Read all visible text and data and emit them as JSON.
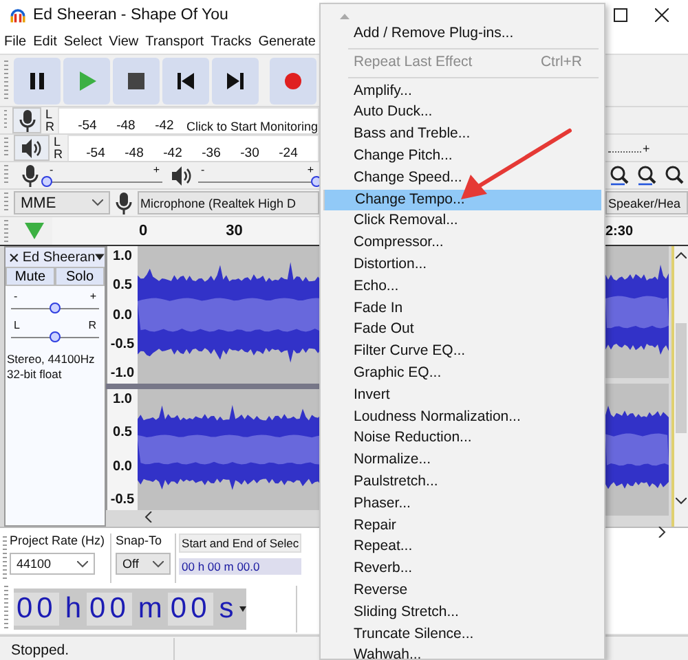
{
  "window": {
    "title": "Ed Sheeran - Shape Of You"
  },
  "menu_bar": [
    "File",
    "Edit",
    "Select",
    "View",
    "Transport",
    "Tracks",
    "Generate"
  ],
  "transport_buttons": [
    {
      "kind": "pause"
    },
    {
      "kind": "play"
    },
    {
      "kind": "stop"
    },
    {
      "kind": "skip_start"
    },
    {
      "kind": "skip_end"
    },
    {
      "kind": "record"
    }
  ],
  "record_meter": {
    "channels": [
      "L",
      "R"
    ],
    "ticks": [
      "-54",
      "-48",
      "-42"
    ],
    "prompt": "Click to Start Monitoring"
  },
  "playback_meter": {
    "channels": [
      "L",
      "R"
    ],
    "ticks": [
      "-54",
      "-48",
      "-42",
      "-36",
      "-30",
      "-24"
    ]
  },
  "mixer": {
    "record": {
      "minus": "-",
      "plus": "+",
      "level": 0
    },
    "playback": {
      "minus": "-",
      "plus": "+",
      "level": 1
    },
    "right_slider": {
      "plus": "+"
    }
  },
  "devices": {
    "host": "MME",
    "recording_device": "Microphone (Realtek High D",
    "playback_device": "Speaker/Hea"
  },
  "ruler": {
    "labels": [
      "0",
      "30"
    ],
    "right_label": "2:30"
  },
  "track": {
    "name": "Ed Sheeran",
    "mute": "Mute",
    "solo": "Solo",
    "gain": {
      "minus": "-",
      "plus": "+",
      "level": 0.5
    },
    "pan": {
      "left": "L",
      "right": "R",
      "level": 0.5
    },
    "info": [
      "Stereo, 44100Hz",
      "32-bit float"
    ],
    "channels": [
      {
        "scale": [
          "1.0",
          "0.5",
          "0.0",
          "-0.5",
          "-1.0"
        ]
      },
      {
        "scale": [
          "1.0",
          "0.5",
          "0.0",
          "-0.5"
        ]
      }
    ]
  },
  "selection_toolbar": {
    "project_rate_label": "Project Rate (Hz)",
    "project_rate": "44100",
    "snap_label": "Snap-To",
    "snap": "Off",
    "selection_label": "Start and End of Selec",
    "selection_value": "00 h 00 m 00.0"
  },
  "time": [
    "00",
    "h",
    "00",
    "m",
    "00",
    "s"
  ],
  "status": "Stopped.",
  "effect_menu": {
    "items": [
      {
        "kind": "item",
        "label": "Add / Remove Plug-ins...",
        "selected": false,
        "disabled": false
      },
      {
        "kind": "separator"
      },
      {
        "kind": "item",
        "label": "Repeat Last Effect",
        "shortcut": "Ctrl+R",
        "selected": false,
        "disabled": true
      },
      {
        "kind": "separator"
      },
      {
        "kind": "item",
        "label": "Amplify...",
        "selected": false,
        "disabled": false
      },
      {
        "kind": "item",
        "label": "Auto Duck...",
        "selected": false,
        "disabled": false
      },
      {
        "kind": "item",
        "label": "Bass and Treble...",
        "selected": false,
        "disabled": false
      },
      {
        "kind": "item",
        "label": "Change Pitch...",
        "selected": false,
        "disabled": false
      },
      {
        "kind": "item",
        "label": "Change Speed...",
        "selected": false,
        "disabled": false
      },
      {
        "kind": "item",
        "label": "Change Tempo...",
        "selected": true,
        "disabled": false
      },
      {
        "kind": "item",
        "label": "Click Removal...",
        "selected": false,
        "disabled": false
      },
      {
        "kind": "item",
        "label": "Compressor...",
        "selected": false,
        "disabled": false
      },
      {
        "kind": "item",
        "label": "Distortion...",
        "selected": false,
        "disabled": false
      },
      {
        "kind": "item",
        "label": "Echo...",
        "selected": false,
        "disabled": false
      },
      {
        "kind": "item",
        "label": "Fade In",
        "selected": false,
        "disabled": false
      },
      {
        "kind": "item",
        "label": "Fade Out",
        "selected": false,
        "disabled": false
      },
      {
        "kind": "item",
        "label": "Filter Curve EQ...",
        "selected": false,
        "disabled": false
      },
      {
        "kind": "item",
        "label": "Graphic EQ...",
        "selected": false,
        "disabled": false
      },
      {
        "kind": "item",
        "label": "Invert",
        "selected": false,
        "disabled": false
      },
      {
        "kind": "item",
        "label": "Loudness Normalization...",
        "selected": false,
        "disabled": false
      },
      {
        "kind": "item",
        "label": "Noise Reduction...",
        "selected": false,
        "disabled": false
      },
      {
        "kind": "item",
        "label": "Normalize...",
        "selected": false,
        "disabled": false
      },
      {
        "kind": "item",
        "label": "Paulstretch...",
        "selected": false,
        "disabled": false
      },
      {
        "kind": "item",
        "label": "Phaser...",
        "selected": false,
        "disabled": false
      },
      {
        "kind": "item",
        "label": "Repair",
        "selected": false,
        "disabled": false
      },
      {
        "kind": "item",
        "label": "Repeat...",
        "selected": false,
        "disabled": false
      },
      {
        "kind": "item",
        "label": "Reverb...",
        "selected": false,
        "disabled": false
      },
      {
        "kind": "item",
        "label": "Reverse",
        "selected": false,
        "disabled": false
      },
      {
        "kind": "item",
        "label": "Sliding Stretch...",
        "selected": false,
        "disabled": false
      },
      {
        "kind": "item",
        "label": "Truncate Silence...",
        "selected": false,
        "disabled": false
      },
      {
        "kind": "item",
        "label": "Wahwah...",
        "selected": false,
        "disabled": false
      }
    ]
  },
  "annotation": {
    "kind": "arrow"
  }
}
